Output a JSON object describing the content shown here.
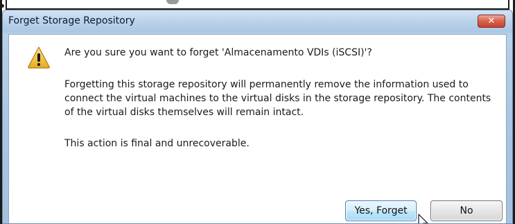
{
  "dialog": {
    "title": "Forget Storage Repository",
    "close_glyph": "✕",
    "question": "Are you sure you want to forget 'Almacenamento VDIs (iSCSI)'?",
    "body": "Forgetting this storage repository will permanently remove the information used to connect the virtual machines to the virtual disks in the storage repository. The contents of the virtual disks themselves will remain intact.",
    "final": "This action is final and unrecoverable.",
    "buttons": {
      "yes": "Yes, Forget",
      "no": "No"
    },
    "icon": "warning-icon"
  },
  "colors": {
    "titlebar": "#bcd2ea",
    "close_button": "#d9604a",
    "warning_fill": "#f2c230",
    "primary_button_border": "#3c7fb1"
  }
}
